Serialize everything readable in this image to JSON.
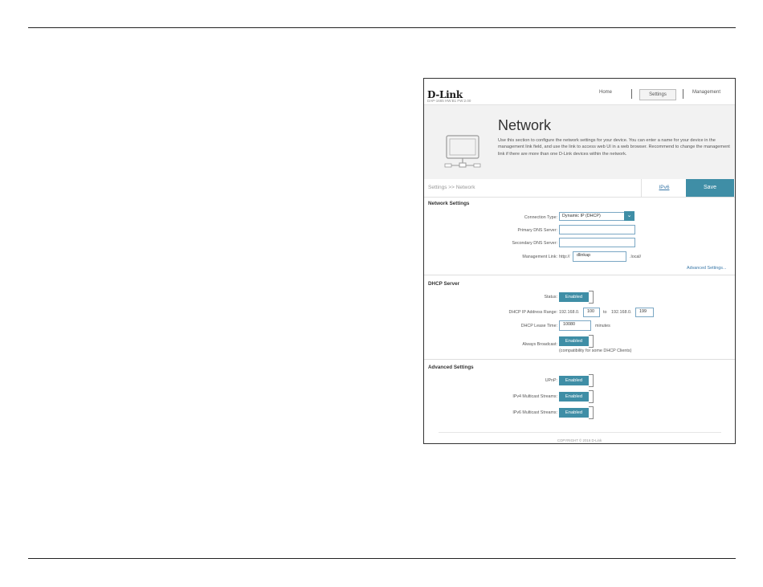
{
  "header": {
    "logo": "D-Link",
    "model": "DAP-1665 HW:B1 FW:2.00",
    "nav": {
      "home": "Home",
      "settings": "Settings",
      "management": "Management"
    }
  },
  "banner": {
    "title": "Network",
    "description": "Use this section to configure the network settings for your device. You can enter a name for your device in the management link field, and use the link to access web UI in a web browser. Recommend to change the management link if there are more than one D-Link devices within the network."
  },
  "breadcrumb": "Settings >> Network",
  "tabs": {
    "ipv6": "IPv6",
    "save": "Save"
  },
  "network_settings": {
    "title": "Network Settings",
    "connection_type_label": "Connection Type:",
    "connection_type_value": "Dynamic IP (DHCP)",
    "primary_dns_label": "Primary DNS Server:",
    "primary_dns_value": "",
    "secondary_dns_label": "Secondary DNS Server:",
    "secondary_dns_value": "",
    "management_link_label": "Management Link:",
    "management_link_prefix": "http://",
    "management_link_value": "dlinkap",
    "management_link_suffix": ".local/",
    "advanced_link": "Advanced Settings..."
  },
  "dhcp_server": {
    "title": "DHCP Server",
    "status_label": "Status:",
    "status_value": "Enabled",
    "range_label": "DHCP IP Address Range:",
    "range_prefix_start": "192.168.0.",
    "range_start": "100",
    "range_to": "to",
    "range_prefix_end": "192.168.0.",
    "range_end": "199",
    "lease_label": "DHCP Lease Time:",
    "lease_value": "10080",
    "lease_unit": "minutes",
    "broadcast_label": "Always Broadcast:",
    "broadcast_value": "Enabled",
    "broadcast_note": "(compatibility for some DHCP Clients)"
  },
  "advanced_settings": {
    "title": "Advanced Settings",
    "upnp_label": "UPnP:",
    "upnp_value": "Enabled",
    "ipv4_multicast_label": "IPv4 Multicast Streams:",
    "ipv4_multicast_value": "Enabled",
    "ipv6_multicast_label": "IPv6 Multicast Streams:",
    "ipv6_multicast_value": "Enabled"
  },
  "footer": {
    "copyright": "COPYRIGHT © 2016 D-Link"
  },
  "colors": {
    "accent": "#3f8ea6",
    "link": "#3a78a8",
    "banner_bg": "#f2f2f2"
  }
}
